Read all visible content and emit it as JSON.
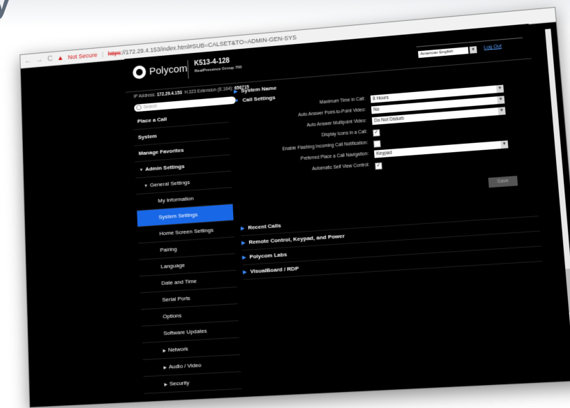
{
  "browser": {
    "not_secure": "Not Secure",
    "url_protocol": "https",
    "url_rest": "://172.29.4.153/index.html#SUB=CALSET&TO=ADMIN-GEN-SYS"
  },
  "header": {
    "logo_text": "Polycom",
    "system_name": "K513-4-128",
    "system_model": "RealPresence Group 700",
    "language": "American English",
    "logout": "Log Out"
  },
  "info": {
    "ip_label": "IP Address:",
    "ip_value": "172.29.4.153",
    "h323_label": "H.323 Extension (E.164):",
    "h323_value": "656715"
  },
  "search": {
    "placeholder": "Search"
  },
  "sidebar": {
    "place_call": "Place a Call",
    "system": "System",
    "manage_favorites": "Manage Favorites",
    "admin_settings": "Admin Settings",
    "general_settings": "General Settings",
    "my_information": "My Information",
    "system_settings": "System Settings",
    "home_screen_settings": "Home Screen Settings",
    "pairing": "Pairing",
    "language": "Language",
    "date_time": "Date and Time",
    "serial_ports": "Serial Ports",
    "options": "Options",
    "software_updates": "Software Updates",
    "network": "Network",
    "audio_video": "Audio / Video",
    "security": "Security"
  },
  "main": {
    "system_name": "System Name",
    "call_settings": "Call Settings",
    "fields": {
      "max_time_label": "Maximum Time in Call:",
      "max_time_value": "8 Hours",
      "auto_p2p_label": "Auto Answer Point-to-Point Video:",
      "auto_p2p_value": "No",
      "auto_multi_label": "Auto Answer Multipoint Video:",
      "auto_multi_value": "Do Not Disturb",
      "display_icons_label": "Display Icons in a Call:",
      "flashing_label": "Enable Flashing Incoming Call Notification:",
      "preferred_nav_label": "Preferred Place a Call Navigation:",
      "preferred_nav_value": "Keypad",
      "auto_selfview_label": "Automatic Self View Control:"
    },
    "checks": {
      "display_icons": true,
      "flashing": false,
      "auto_selfview": true
    },
    "save": "Save",
    "recent_calls": "Recent Calls",
    "remote_control": "Remote Control, Keypad, and Power",
    "polycom_labs": "Polycom Labs",
    "visualboard": "VisualBoard / RDP"
  },
  "colors": {
    "accent": "#1867e6",
    "link": "#5aa1ff",
    "warning": "#d01717"
  }
}
